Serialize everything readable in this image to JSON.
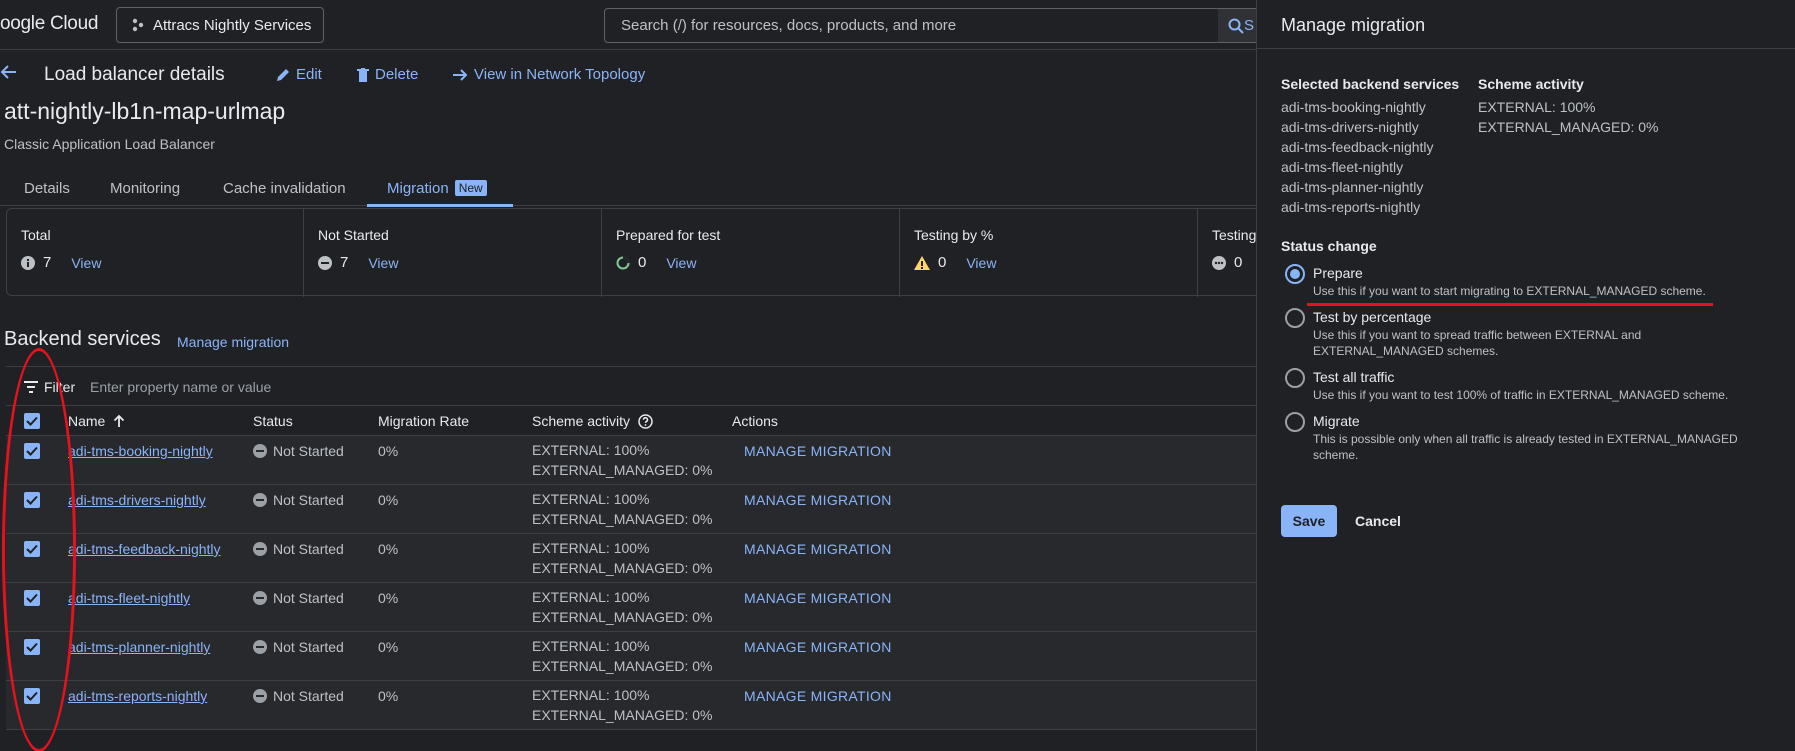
{
  "topbar": {
    "logo": "oogle Cloud",
    "project": "Attracs Nightly Services",
    "search_placeholder": "Search (/) for resources, docs, products, and more",
    "search_button": "S"
  },
  "header": {
    "title": "Load balancer details",
    "edit": "Edit",
    "delete": "Delete",
    "view_topology": "View in Network Topology"
  },
  "lb": {
    "name": "att-nightly-lb1n-map-urlmap",
    "type": "Classic Application Load Balancer"
  },
  "tabs": [
    {
      "label": "Details"
    },
    {
      "label": "Monitoring"
    },
    {
      "label": "Cache invalidation"
    },
    {
      "label": "Migration",
      "badge": "New"
    }
  ],
  "stats": [
    {
      "label": "Total",
      "value": "7",
      "view": "View"
    },
    {
      "label": "Not Started",
      "value": "7",
      "view": "View"
    },
    {
      "label": "Prepared for test",
      "value": "0",
      "view": "View"
    },
    {
      "label": "Testing by %",
      "value": "0",
      "view": "View"
    },
    {
      "label": "Testing",
      "value": "0",
      "view": ""
    }
  ],
  "backend": {
    "title": "Backend services",
    "manage": "Manage migration",
    "filter_label": "Filter",
    "filter_placeholder": "Enter property name or value",
    "columns": [
      "Name",
      "Status",
      "Migration Rate",
      "Scheme activity",
      "Actions"
    ],
    "rows": [
      {
        "name": "adi-tms-booking-nightly",
        "status": "Not Started",
        "rate": "0%",
        "ext": "EXTERNAL: 100%",
        "extm": "EXTERNAL_MANAGED: 0%",
        "action": "MANAGE MIGRATION"
      },
      {
        "name": "adi-tms-drivers-nightly",
        "status": "Not Started",
        "rate": "0%",
        "ext": "EXTERNAL: 100%",
        "extm": "EXTERNAL_MANAGED: 0%",
        "action": "MANAGE MIGRATION"
      },
      {
        "name": "adi-tms-feedback-nightly",
        "status": "Not Started",
        "rate": "0%",
        "ext": "EXTERNAL: 100%",
        "extm": "EXTERNAL_MANAGED: 0%",
        "action": "MANAGE MIGRATION"
      },
      {
        "name": "adi-tms-fleet-nightly",
        "status": "Not Started",
        "rate": "0%",
        "ext": "EXTERNAL: 100%",
        "extm": "EXTERNAL_MANAGED: 0%",
        "action": "MANAGE MIGRATION"
      },
      {
        "name": "adi-tms-planner-nightly",
        "status": "Not Started",
        "rate": "0%",
        "ext": "EXTERNAL: 100%",
        "extm": "EXTERNAL_MANAGED: 0%",
        "action": "MANAGE MIGRATION"
      },
      {
        "name": "adi-tms-reports-nightly",
        "status": "Not Started",
        "rate": "0%",
        "ext": "EXTERNAL: 100%",
        "extm": "EXTERNAL_MANAGED: 0%",
        "action": "MANAGE MIGRATION"
      }
    ]
  },
  "panel": {
    "title": "Manage migration",
    "selected_heading": "Selected backend services",
    "scheme_heading": "Scheme activity",
    "selected": [
      "adi-tms-booking-nightly",
      "adi-tms-drivers-nightly",
      "adi-tms-feedback-nightly",
      "adi-tms-fleet-nightly",
      "adi-tms-planner-nightly",
      "adi-tms-reports-nightly"
    ],
    "scheme": [
      "EXTERNAL: 100%",
      "EXTERNAL_MANAGED: 0%"
    ],
    "status_change": "Status change",
    "options": [
      {
        "label": "Prepare",
        "desc": "Use this if you want to start migrating to EXTERNAL_MANAGED scheme.",
        "checked": true
      },
      {
        "label": "Test by percentage",
        "desc": "Use this if you want to spread traffic between EXTERNAL and EXTERNAL_MANAGED schemes.",
        "checked": false
      },
      {
        "label": "Test all traffic",
        "desc": "Use this if you want to test 100% of traffic in EXTERNAL_MANAGED scheme.",
        "checked": false
      },
      {
        "label": "Migrate",
        "desc": "This is possible only when all traffic is already tested in EXTERNAL_MANAGED scheme.",
        "checked": false
      }
    ],
    "save": "Save",
    "cancel": "Cancel"
  },
  "colors": {
    "accent": "#8ab4f8",
    "background": "#202124",
    "annotation": "#e8111d"
  }
}
